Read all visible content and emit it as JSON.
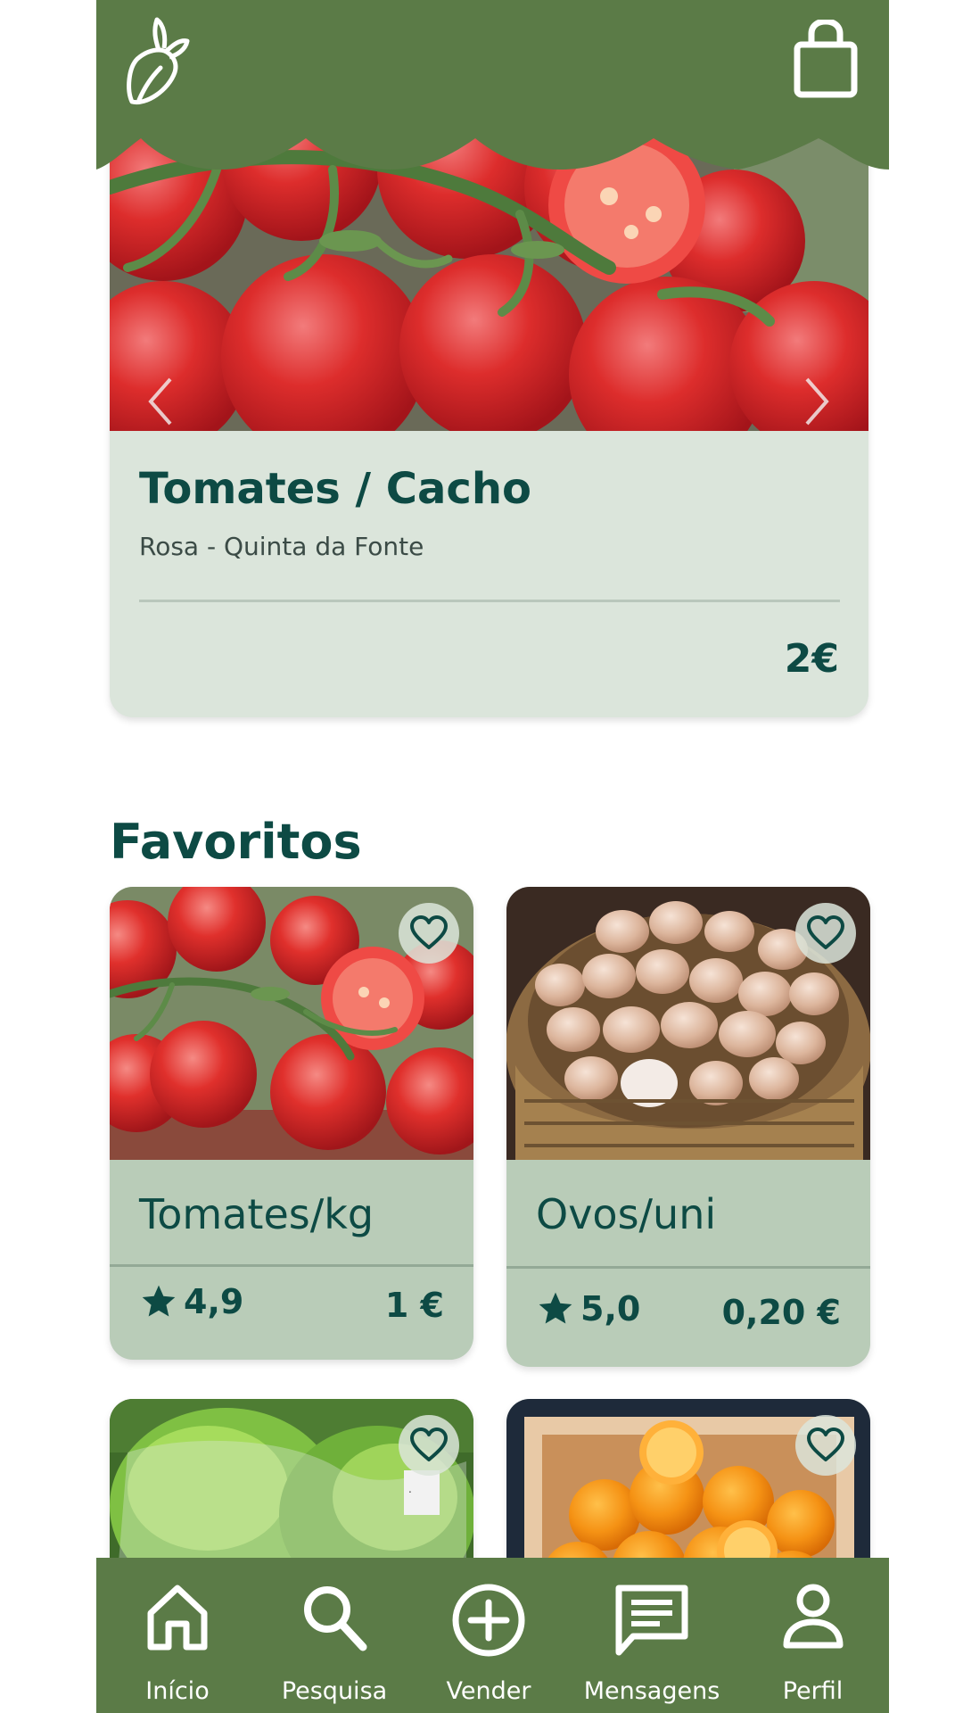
{
  "header": {
    "logo_icon": "beet-sprout-icon",
    "cart_icon": "shopping-bag-icon",
    "brand_color": "#5b7b47"
  },
  "featured": {
    "title": "Tomates / Cacho",
    "seller": "Rosa - Quinta da Fonte",
    "price": "2€",
    "image": "tomatoes-on-vine",
    "prev_icon": "chevron-left-icon",
    "next_icon": "chevron-right-icon"
  },
  "favorites": {
    "title": "Favoritos",
    "items": [
      {
        "name": "Tomates/kg",
        "rating": "4,9",
        "price": "1 €",
        "image": "tomatoes",
        "favorite_icon": "heart-icon"
      },
      {
        "name": "Ovos/uni",
        "rating": "5,0",
        "price": "0,20 €",
        "image": "eggs-basket",
        "favorite_icon": "heart-icon"
      },
      {
        "name": "",
        "rating": "",
        "price": "",
        "image": "lettuce",
        "favorite_icon": "heart-icon"
      },
      {
        "name": "",
        "rating": "",
        "price": "",
        "image": "oranges-box",
        "favorite_icon": "heart-icon"
      }
    ]
  },
  "nav": {
    "items": [
      {
        "label": "Início",
        "icon": "home-icon"
      },
      {
        "label": "Pesquisa",
        "icon": "search-icon"
      },
      {
        "label": "Vender",
        "icon": "plus-circle-icon"
      },
      {
        "label": "Mensagens",
        "icon": "message-icon"
      },
      {
        "label": "Perfil",
        "icon": "person-icon"
      }
    ]
  },
  "colors": {
    "primary_green": "#5b7b47",
    "text_dark": "#0d4a44",
    "card_bg": "#b9ccb8",
    "hero_bg": "#dbe5db"
  }
}
